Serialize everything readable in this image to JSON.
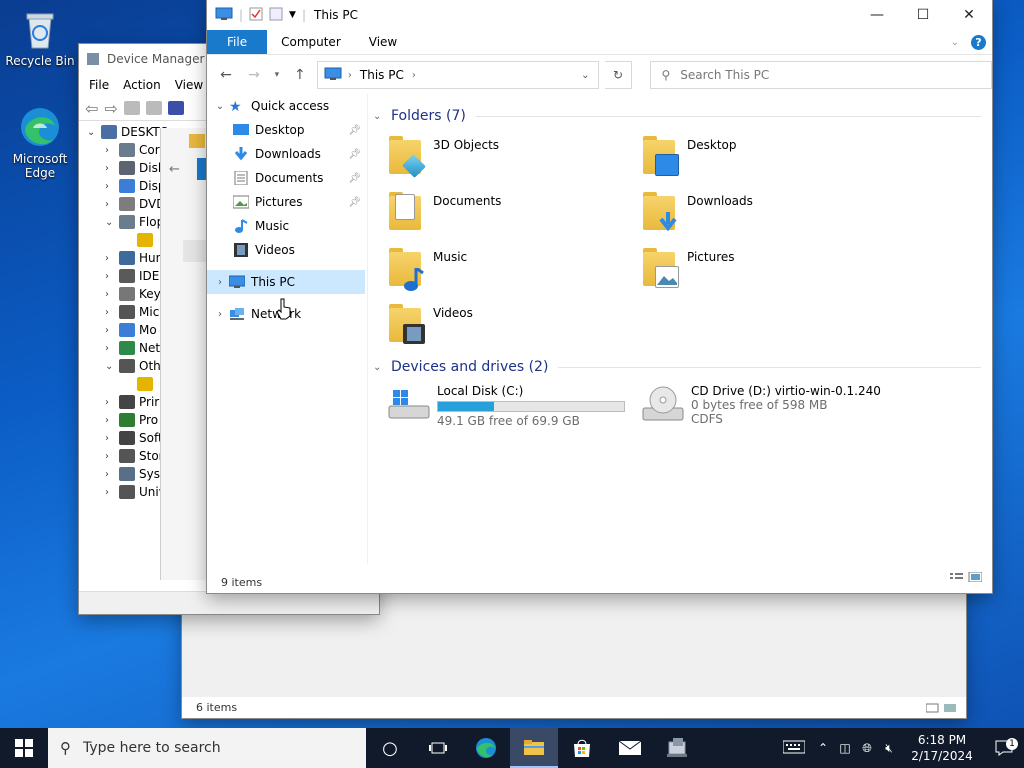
{
  "desktop": {
    "recycle_bin": "Recycle Bin",
    "edge_line1": "Microsoft",
    "edge_line2": "Edge"
  },
  "device_manager": {
    "title": "Device Manager",
    "menu": [
      "File",
      "Action",
      "View"
    ],
    "tree": [
      {
        "label": "DESKTO",
        "chevron": "collapse",
        "indent": 0
      },
      {
        "label": "Cor",
        "chevron": "expand",
        "indent": 1
      },
      {
        "label": "Disk",
        "chevron": "expand",
        "indent": 1
      },
      {
        "label": "Disp",
        "chevron": "expand",
        "indent": 1
      },
      {
        "label": "DVD",
        "chevron": "expand",
        "indent": 1
      },
      {
        "label": "Flop",
        "chevron": "collapse",
        "indent": 1
      },
      {
        "label": "",
        "chevron": "",
        "indent": 2
      },
      {
        "label": "Hun",
        "chevron": "expand",
        "indent": 1
      },
      {
        "label": "IDE",
        "chevron": "expand",
        "indent": 1
      },
      {
        "label": "Key",
        "chevron": "expand",
        "indent": 1
      },
      {
        "label": "Mic",
        "chevron": "expand",
        "indent": 1
      },
      {
        "label": "Mo",
        "chevron": "expand",
        "indent": 1
      },
      {
        "label": "Net",
        "chevron": "expand",
        "indent": 1
      },
      {
        "label": "Oth",
        "chevron": "collapse",
        "indent": 1
      },
      {
        "label": "",
        "chevron": "",
        "indent": 2
      },
      {
        "label": "Prir",
        "chevron": "expand",
        "indent": 1
      },
      {
        "label": "Pro",
        "chevron": "expand",
        "indent": 1
      },
      {
        "label": "Soft",
        "chevron": "expand",
        "indent": 1
      },
      {
        "label": "Stor",
        "chevron": "expand",
        "indent": 1
      },
      {
        "label": "Syst",
        "chevron": "expand",
        "indent": 1
      },
      {
        "label": "Univ",
        "chevron": "expand",
        "indent": 1
      }
    ]
  },
  "back_window": {
    "status": "6 items"
  },
  "explorer": {
    "title": "This PC",
    "ribbon_tabs": [
      "File",
      "Computer",
      "View"
    ],
    "address": {
      "location": "This PC"
    },
    "search_placeholder": "Search This PC",
    "nav": {
      "quick_access": "Quick access",
      "items": [
        "Desktop",
        "Downloads",
        "Documents",
        "Pictures",
        "Music",
        "Videos"
      ],
      "this_pc": "This PC",
      "network": "Network"
    },
    "folders_header": "Folders (7)",
    "folders": [
      "3D Objects",
      "Desktop",
      "Documents",
      "Downloads",
      "Music",
      "Pictures",
      "Videos"
    ],
    "drives_header": "Devices and drives (2)",
    "drives": [
      {
        "name": "Local Disk (C:)",
        "free": "49.1 GB free of 69.9 GB",
        "used_fraction": 0.3,
        "fs": ""
      },
      {
        "name": "CD Drive (D:) virtio-win-0.1.240",
        "free": "0 bytes free of 598 MB",
        "used_fraction": null,
        "fs": "CDFS"
      }
    ],
    "status": "9 items"
  },
  "taskbar": {
    "search_placeholder": "Type here to search",
    "time": "6:18 PM",
    "date": "2/17/2024",
    "notification_count": "1"
  },
  "colors": {
    "accent": "#1979ca",
    "selection": "#cce8ff",
    "drive_bar": "#26a0da"
  }
}
